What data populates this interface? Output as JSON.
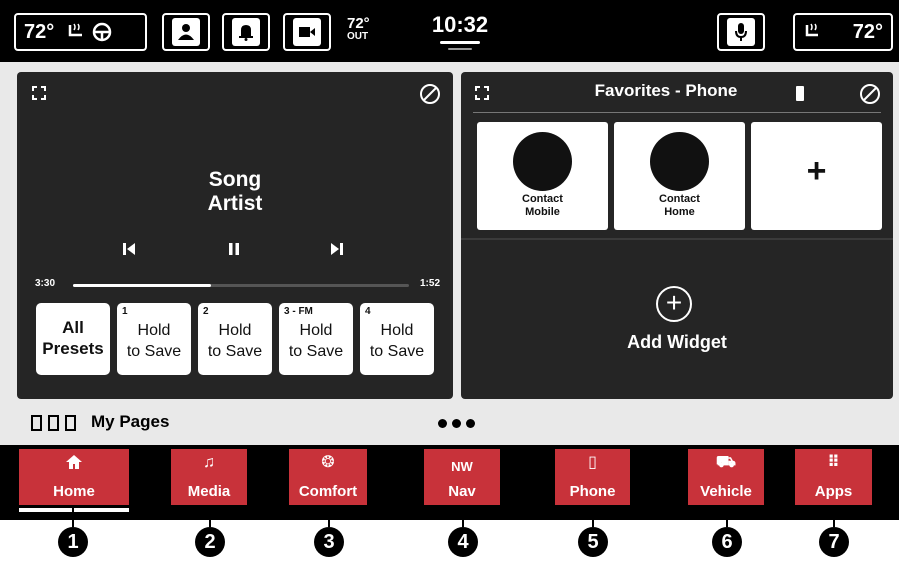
{
  "topbar": {
    "left_temp": "72°",
    "right_temp": "72°",
    "outside_temp": "72°",
    "outside_label": "OUT",
    "clock": "10:32",
    "icons": [
      "heated-seat-icon",
      "steering-wheel-heat-icon",
      "profile-icon",
      "notification-bell-icon",
      "camera-icon",
      "microphone-icon",
      "heated-seat-icon"
    ]
  },
  "media": {
    "song": "Song",
    "artist": "Artist",
    "elapsed": "3:30",
    "remaining": "1:52",
    "progress": 0.41,
    "presets": [
      {
        "num": "",
        "line1": "All",
        "line2": "Presets"
      },
      {
        "num": "1",
        "line1": "Hold",
        "line2": "to Save"
      },
      {
        "num": "2",
        "line1": "Hold",
        "line2": "to Save"
      },
      {
        "num": "3 - FM",
        "line1": "Hold",
        "line2": "to Save"
      },
      {
        "num": "4",
        "line1": "Hold",
        "line2": "to Save"
      }
    ]
  },
  "favorites": {
    "title": "Favorites - Phone",
    "contacts": [
      {
        "line1": "Contact",
        "line2": "Mobile"
      },
      {
        "line1": "Contact",
        "line2": "Home"
      }
    ],
    "add_symbol": "+",
    "add_widget": "Add Widget"
  },
  "pages": {
    "label": "My Pages"
  },
  "nav": {
    "items": [
      {
        "label": "Home",
        "glyph": "⌂"
      },
      {
        "label": "Media",
        "glyph": "♫"
      },
      {
        "label": "Comfort",
        "glyph": "❂"
      },
      {
        "label": "Nav",
        "glyph": "NW"
      },
      {
        "label": "Phone",
        "glyph": "▯"
      },
      {
        "label": "Vehicle",
        "glyph": "⛟"
      },
      {
        "label": "Apps",
        "glyph": "⠿"
      }
    ],
    "active": "Home",
    "accent_color": "#c8323a"
  },
  "callouts": [
    "1",
    "2",
    "3",
    "4",
    "5",
    "6",
    "7"
  ]
}
